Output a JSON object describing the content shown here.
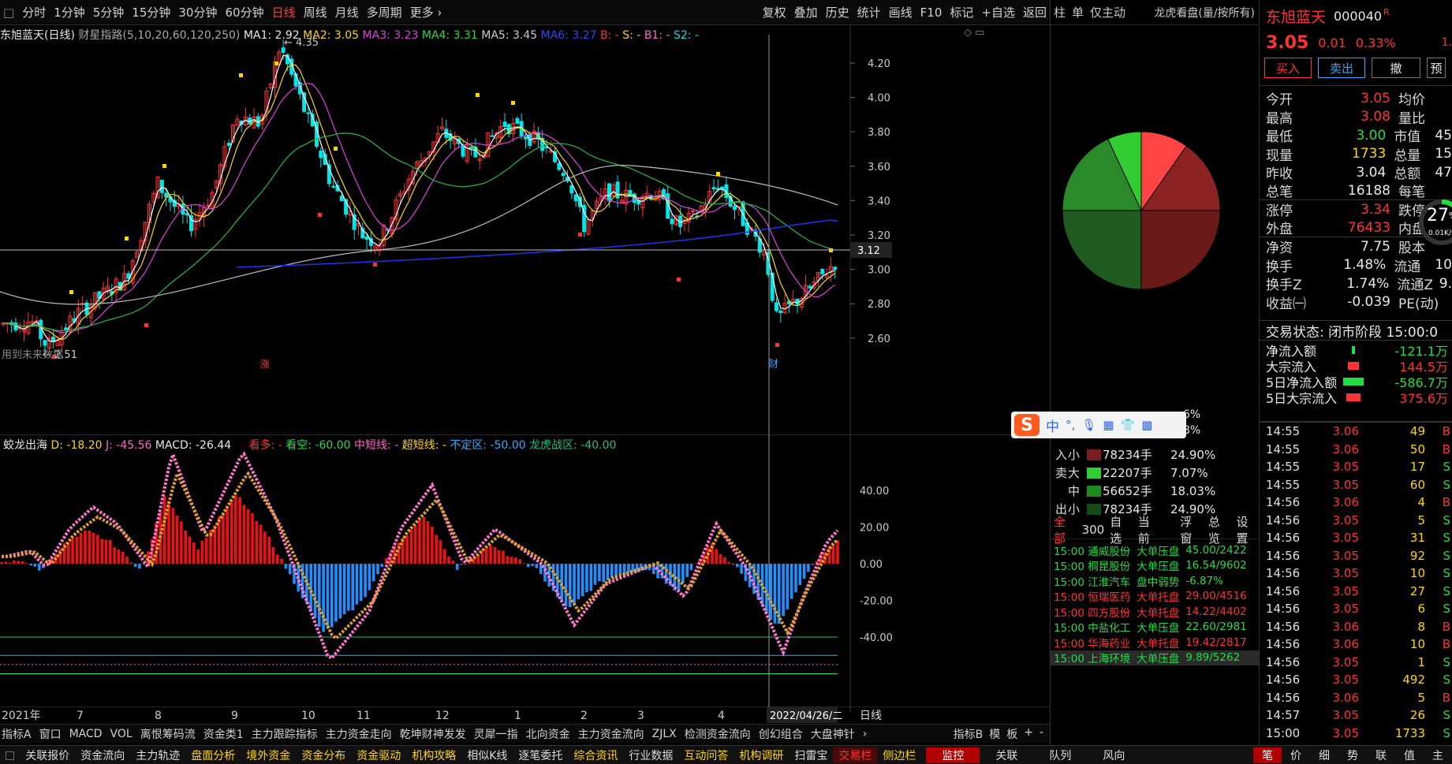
{
  "periods": [
    "分时",
    "1分钟",
    "5分钟",
    "15分钟",
    "30分钟",
    "60分钟",
    "日线",
    "周线",
    "月线",
    "多周期",
    "更多"
  ],
  "active_period": "日线",
  "tools": [
    "复权",
    "叠加",
    "历史",
    "统计",
    "画线",
    "F10",
    "标记",
    "+自选",
    "返回"
  ],
  "main_legend": {
    "name": "东旭蓝天(日线)",
    "indicator": "财星指路(5,10,20,60,120,250)",
    "ma1": "MA1: 2.92",
    "ma2": "MA2: 3.05",
    "ma3": "MA3: 3.23",
    "ma4": "MA4: 3.31",
    "ma5": "MA5: 3.45",
    "ma6": "MA6: 3.27",
    "b": "B: -",
    "s": "S: -",
    "b1": "B1: -",
    "s2": "S2: -"
  },
  "main_axis": [
    "4.20",
    "4.00",
    "3.80",
    "3.60",
    "3.40",
    "3.20",
    "3.00",
    "2.80",
    "2.60"
  ],
  "crosshair_price": "3.12",
  "annotations": {
    "high": "4.35",
    "low": "2.51",
    "note": "用到未来数据",
    "cai": "财",
    "zhang": "涨"
  },
  "sub_legend": {
    "name": "蛟龙出海",
    "d": "D: -18.20",
    "j": "J: -45.56",
    "macd": "MACD: -26.44",
    "kan_duo": "看多: -",
    "kan_kong": "看空: -60.00",
    "zhongduan": "中短线: -",
    "chaoduan": "超短线: -",
    "buding": "不定区: -50.00",
    "longhu": "龙虎战区: -40.00"
  },
  "sub_axis": [
    "40.00",
    "20.00",
    "0.00",
    "-20.00",
    "-40.00"
  ],
  "x_labels": [
    "2021年",
    "7",
    "8",
    "9",
    "10",
    "11",
    "12",
    "1",
    "2",
    "3",
    "4"
  ],
  "crosshair_date": "2022/04/26/二",
  "period_label": "日线",
  "indicator_tabs": [
    "指标A",
    "窗口",
    "MACD",
    "VOL",
    "离恨筹码流",
    "资金类1",
    "主力跟踪指标",
    "主力资金走向",
    "乾坤财神发发",
    "灵犀一指",
    "北向资金",
    "主力资金流向",
    "ZJLX",
    "检测资金流向",
    "创幻组合",
    "大盘神针"
  ],
  "indicator_right": [
    "指标B",
    "模",
    "板",
    "+",
    "-"
  ],
  "bottom_tabs": [
    {
      "t": "关联报价",
      "c": "#ddd"
    },
    {
      "t": "资金流向",
      "c": "#ddd"
    },
    {
      "t": "主力轨迹",
      "c": "#ddd"
    },
    {
      "t": "盘面分析",
      "c": "#ffd700"
    },
    {
      "t": "境外资金",
      "c": "#ffd700"
    },
    {
      "t": "资金分布",
      "c": "#ffd700"
    },
    {
      "t": "资金驱动",
      "c": "#ffd700"
    },
    {
      "t": "机构攻略",
      "c": "#ffd700"
    },
    {
      "t": "相似K线",
      "c": "#ddd"
    },
    {
      "t": "逐笔委托",
      "c": "#ddd"
    },
    {
      "t": "综合资讯",
      "c": "#ffd700"
    },
    {
      "t": "行业数据",
      "c": "#ddd"
    },
    {
      "t": "互动问答",
      "c": "#ffd700"
    },
    {
      "t": "机构调研",
      "c": "#ffd700"
    },
    {
      "t": "扫雷宝",
      "c": "#ddd"
    },
    {
      "t": "交易栏",
      "c": "#ff3333"
    },
    {
      "t": "侧边栏",
      "c": "#ffd700"
    }
  ],
  "bottom_right_tabs": [
    "监控",
    "关联",
    "队列",
    "风向"
  ],
  "bottom_far": [
    "笔",
    "价",
    "细",
    "势",
    "联",
    "值",
    "主"
  ],
  "mid_tabs": [
    "柱",
    "单",
    "仅主动",
    "龙虎看盘(量/按所有)"
  ],
  "flows": [
    {
      "side": "入",
      "size": "小",
      "vol": "78234手",
      "pct": "24.90%",
      "color": "#7a1f1f"
    },
    {
      "side": "卖",
      "size": "大",
      "vol": "22207手",
      "pct": "7.07%",
      "color": "#33cc33"
    },
    {
      "side": "",
      "size": "中",
      "vol": "56652手",
      "pct": "18.03%",
      "color": "#1f8a1f"
    },
    {
      "side": "出",
      "size": "小",
      "vol": "78234手",
      "pct": "24.90%",
      "color": "#144d14"
    }
  ],
  "flows_top_partial": [
    "6%",
    "8%"
  ],
  "deal_header": [
    "全部",
    "300",
    "自选",
    "当前",
    "浮窗",
    "总览",
    "设置"
  ],
  "deals": [
    {
      "time": "15:00",
      "name": "通威股份",
      "type": "大单压盘",
      "val": "45.00/2422",
      "c": "#22dd44"
    },
    {
      "time": "15:00",
      "name": "桐昆股份",
      "type": "大单压盘",
      "val": "16.54/9602",
      "c": "#22dd44"
    },
    {
      "time": "15:00",
      "name": "江淮汽车",
      "type": "盘中弱势",
      "val": "-6.87%",
      "c": "#22dd44"
    },
    {
      "time": "15:00",
      "name": "恒瑞医药",
      "type": "大单托盘",
      "val": "29.00/4516",
      "c": "#ff3333"
    },
    {
      "time": "15:00",
      "name": "四方股份",
      "type": "大单托盘",
      "val": "14.22/4402",
      "c": "#ff3333"
    },
    {
      "time": "15:00",
      "name": "中盐化工",
      "type": "大单压盘",
      "val": "22.60/2981",
      "c": "#22dd44"
    },
    {
      "time": "15:00",
      "name": "华海药业",
      "type": "大单托盘",
      "val": "19.42/2817",
      "c": "#ff3333"
    },
    {
      "time": "15:00",
      "name": "上海环境",
      "type": "大单压盘",
      "val": "9.89/5262",
      "c": "#22dd44"
    }
  ],
  "ime": {
    "lang": "中",
    "punct": "°,"
  },
  "stock": {
    "name": "东旭蓝天",
    "code": "000040",
    "flag": "R",
    "price": "3.05",
    "change": "0.01",
    "pct": "0.33%",
    "extra": "1."
  },
  "actions": {
    "buy": "买入",
    "sell": "卖出",
    "cancel": "撤",
    "more": "预"
  },
  "quote": [
    {
      "l": "今开",
      "v": "3.05",
      "vc": "#ff3333",
      "l2": "均价",
      "v2": ""
    },
    {
      "l": "最高",
      "v": "3.08",
      "vc": "#ff3333",
      "l2": "量比",
      "v2": ""
    },
    {
      "l": "最低",
      "v": "3.00",
      "vc": "#22dd44",
      "l2": "市值",
      "v2": "45"
    },
    {
      "l": "现量",
      "v": "1733",
      "vc": "#ffd700",
      "l2": "总量",
      "v2": "15"
    },
    {
      "l": "昨收",
      "v": "3.04",
      "vc": "#e8e8e8",
      "l2": "总额",
      "v2": "47"
    },
    {
      "l": "总笔",
      "v": "16188",
      "vc": "#e8e8e8",
      "l2": "每笔",
      "v2": ""
    },
    {
      "l": "涨停",
      "v": "3.34",
      "vc": "#ff3333",
      "l2": "跌停",
      "v2": ""
    },
    {
      "l": "外盘",
      "v": "76433",
      "vc": "#ff3333",
      "l2": "内盘",
      "v2": ""
    },
    {
      "l": "净资",
      "v": "7.75",
      "vc": "#e8e8e8",
      "l2": "股本",
      "v2": ""
    },
    {
      "l": "换手",
      "v": "1.48%",
      "vc": "#e8e8e8",
      "l2": "流通",
      "v2": "10"
    },
    {
      "l": "换手Z",
      "v": "1.74%",
      "vc": "#e8e8e8",
      "l2": "流通Z",
      "v2": "9."
    },
    {
      "l": "收益㈠",
      "v": "-0.039",
      "vc": "#e8e8e8",
      "l2": "PE(动)",
      "v2": ""
    }
  ],
  "gauge": {
    "pct": "27",
    "unit": "%",
    "speed": "0.01K/s"
  },
  "trade_status": "交易状态: 闭市阶段 15:00:0",
  "fundflow": [
    {
      "l": "净流入额",
      "v": "-121.1万",
      "vc": "#22dd44",
      "bar": "#22dd44",
      "bw": 4
    },
    {
      "l": "大宗流入",
      "v": "144.5万",
      "vc": "#ff3333",
      "bar": "#ff3333",
      "bw": 14
    },
    {
      "l": "5日净流入额",
      "v": "-586.7万",
      "vc": "#22dd44",
      "bar": "#22dd44",
      "bw": 26
    },
    {
      "l": "5日大宗流入",
      "v": "375.6万",
      "vc": "#ff3333",
      "bar": "#ff3333",
      "bw": 18
    }
  ],
  "ticks": [
    {
      "t": "14:55",
      "p": "3.06",
      "pc": "#ff3333",
      "q": "49",
      "d": "B",
      "dc": "#ff3333"
    },
    {
      "t": "14:55",
      "p": "3.06",
      "pc": "#ff3333",
      "q": "50",
      "d": "B",
      "dc": "#ff3333"
    },
    {
      "t": "14:55",
      "p": "3.05",
      "pc": "#ff3333",
      "q": "17",
      "d": "S",
      "dc": "#22dd44"
    },
    {
      "t": "14:55",
      "p": "3.05",
      "pc": "#ff3333",
      "q": "60",
      "d": "S",
      "dc": "#22dd44"
    },
    {
      "t": "14:56",
      "p": "3.06",
      "pc": "#ff3333",
      "q": "4",
      "d": "B",
      "dc": "#ff3333"
    },
    {
      "t": "14:56",
      "p": "3.05",
      "pc": "#ff3333",
      "q": "5",
      "d": "S",
      "dc": "#22dd44"
    },
    {
      "t": "14:56",
      "p": "3.05",
      "pc": "#ff3333",
      "q": "31",
      "d": "S",
      "dc": "#22dd44"
    },
    {
      "t": "14:56",
      "p": "3.05",
      "pc": "#ff3333",
      "q": "92",
      "d": "S",
      "dc": "#22dd44"
    },
    {
      "t": "14:56",
      "p": "3.05",
      "pc": "#ff3333",
      "q": "10",
      "d": "S",
      "dc": "#22dd44"
    },
    {
      "t": "14:56",
      "p": "3.05",
      "pc": "#ff3333",
      "q": "27",
      "d": "S",
      "dc": "#22dd44"
    },
    {
      "t": "14:56",
      "p": "3.05",
      "pc": "#ff3333",
      "q": "6",
      "d": "S",
      "dc": "#22dd44"
    },
    {
      "t": "14:56",
      "p": "3.06",
      "pc": "#ff3333",
      "q": "8",
      "d": "B",
      "dc": "#ff3333"
    },
    {
      "t": "14:56",
      "p": "3.06",
      "pc": "#ff3333",
      "q": "10",
      "d": "B",
      "dc": "#ff3333"
    },
    {
      "t": "14:56",
      "p": "3.05",
      "pc": "#ff3333",
      "q": "1",
      "d": "S",
      "dc": "#22dd44"
    },
    {
      "t": "14:56",
      "p": "3.05",
      "pc": "#ff3333",
      "q": "492",
      "d": "S",
      "dc": "#22dd44"
    },
    {
      "t": "14:56",
      "p": "3.06",
      "pc": "#ff3333",
      "q": "5",
      "d": "B",
      "dc": "#ff3333"
    },
    {
      "t": "14:57",
      "p": "3.05",
      "pc": "#ff3333",
      "q": "26",
      "d": "S",
      "dc": "#22dd44"
    },
    {
      "t": "15:00",
      "p": "3.05",
      "pc": "#ff3333",
      "q": "1733",
      "d": "S",
      "dc": "#22dd44"
    }
  ],
  "colors": {
    "up": "#ff3333",
    "down": "#00e5e5",
    "ma1": "#ffffff",
    "ma2": "#ffd700",
    "ma3": "#e040e0",
    "ma4": "#22bb44",
    "ma5": "#bbbbbb",
    "ma6": "#2233ee"
  }
}
